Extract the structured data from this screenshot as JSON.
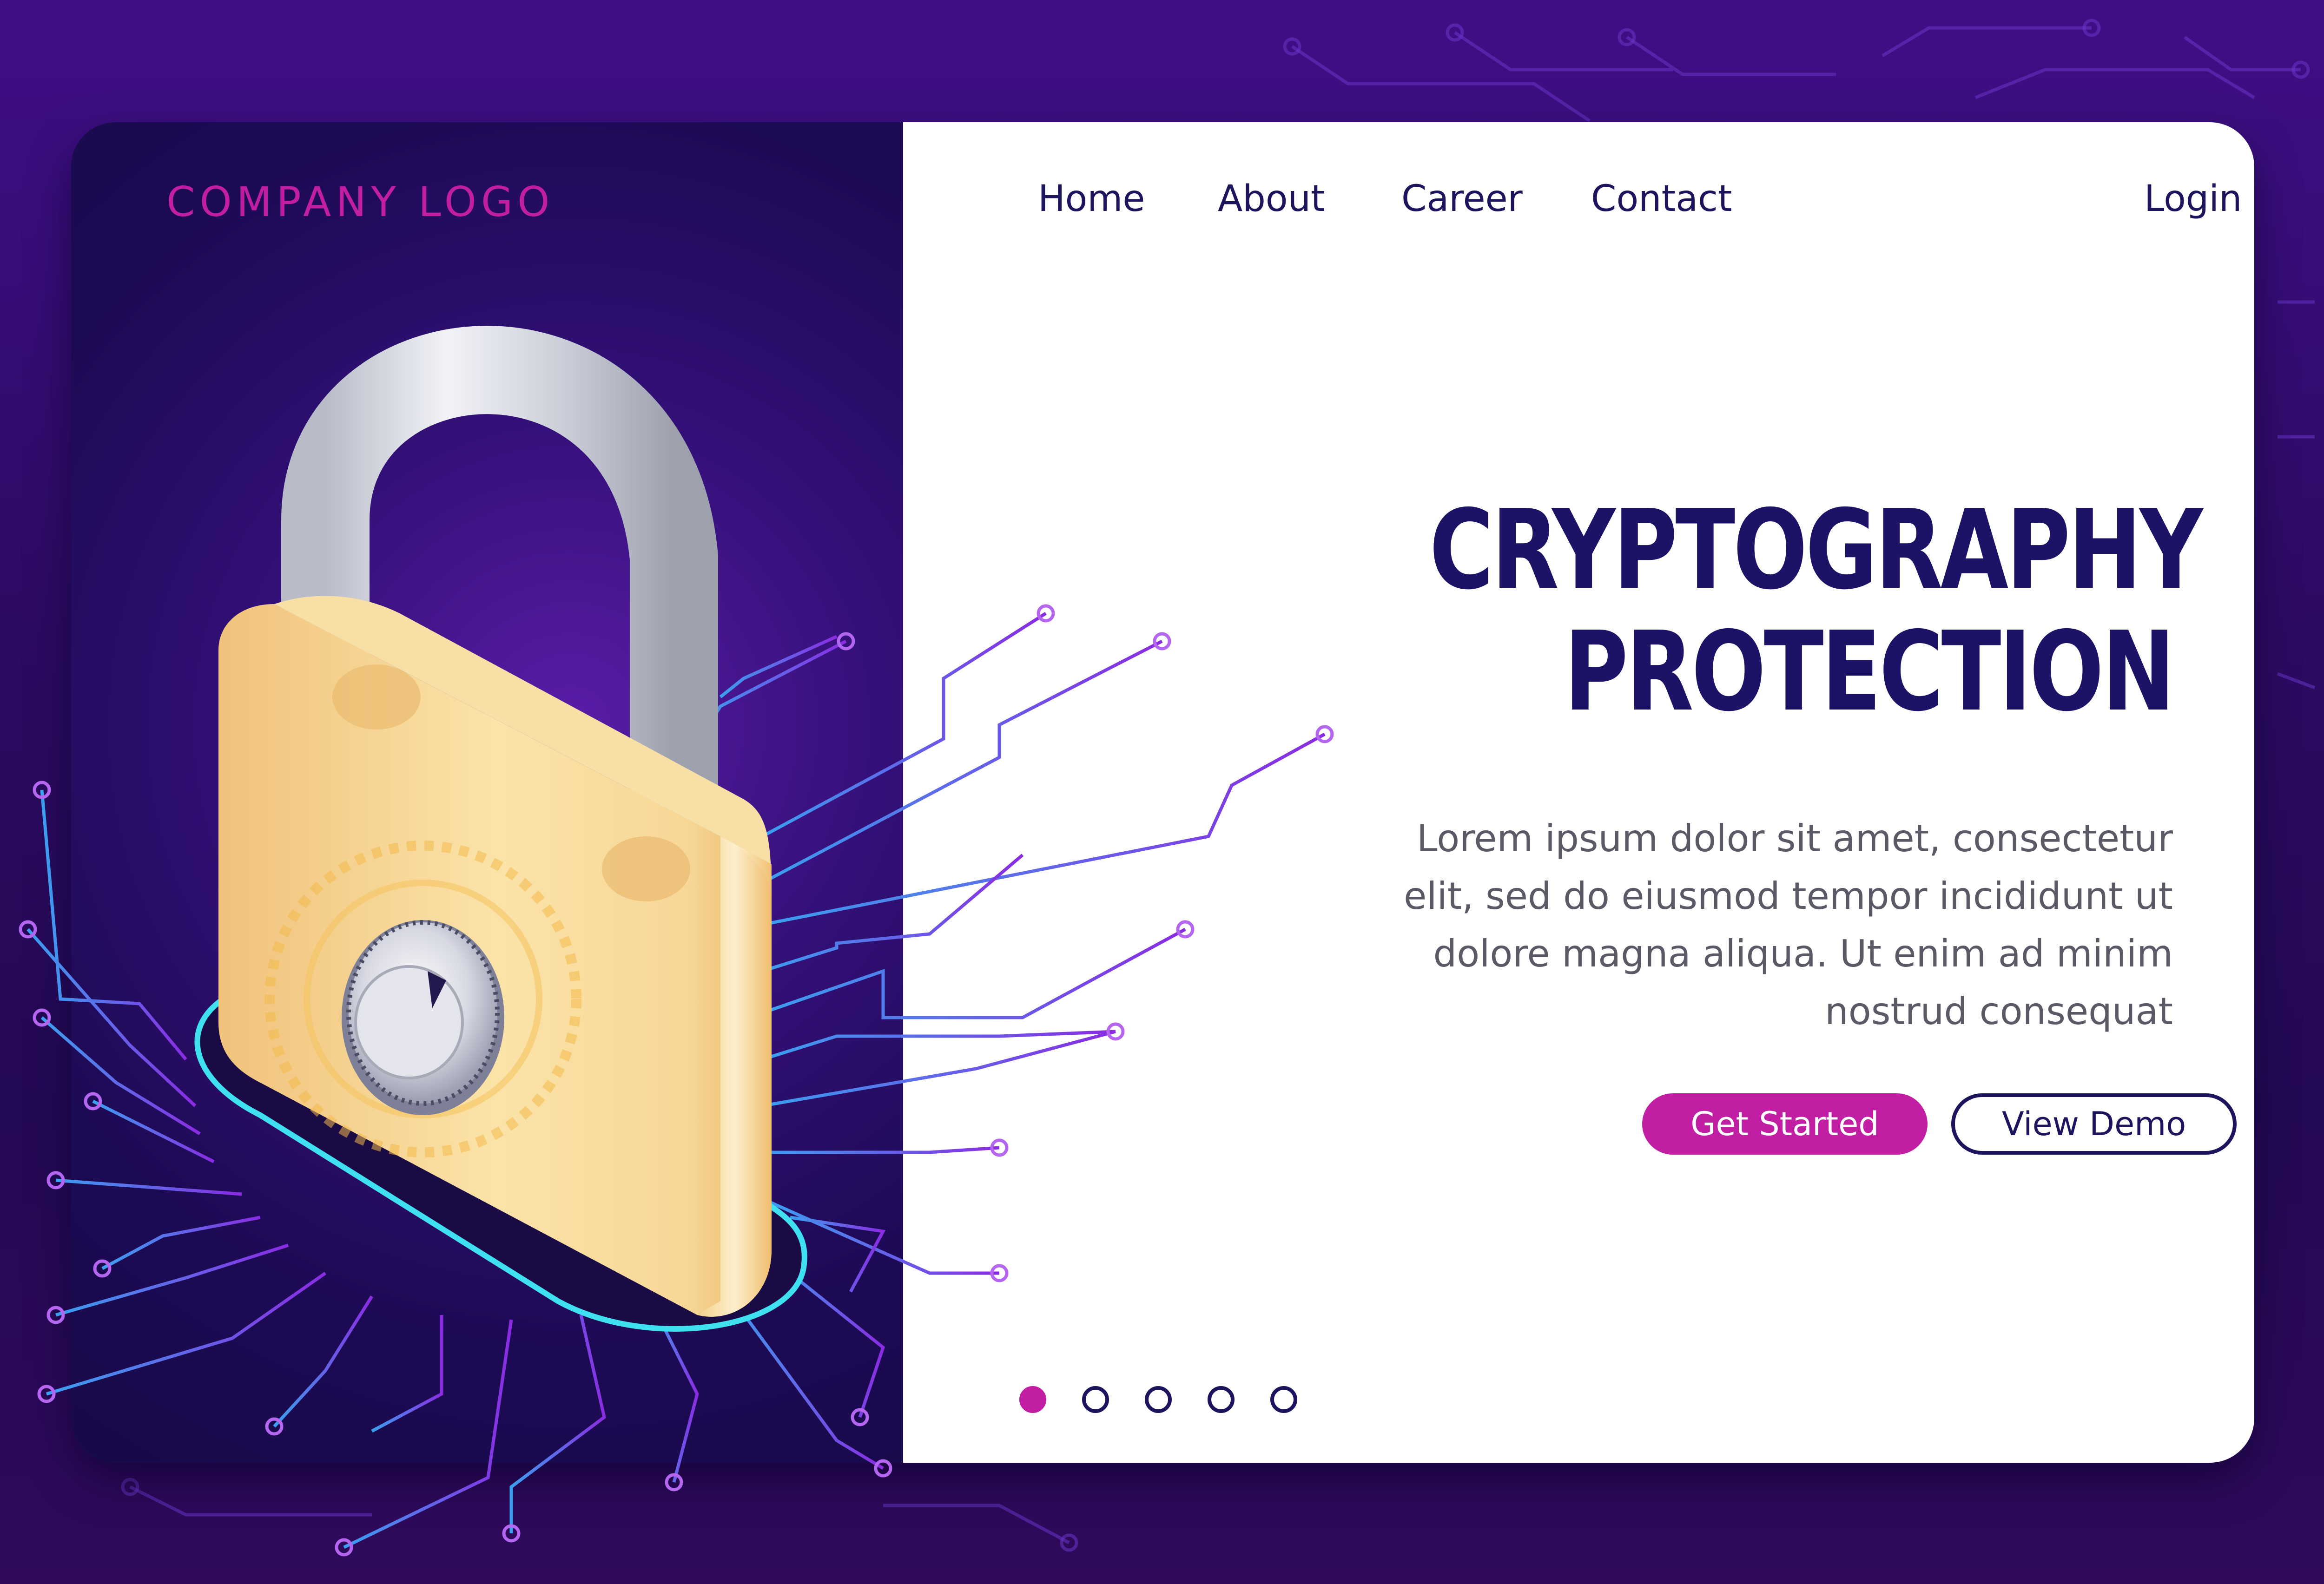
{
  "brand": {
    "logo_text": "COMPANY LOGO"
  },
  "nav": {
    "items": [
      "Home",
      "About",
      "Career",
      "Contact"
    ],
    "login": "Login"
  },
  "hero": {
    "title_line1": "CRYPTOGRAPHY",
    "title_line2": "PROTECTION",
    "description_lines": [
      "Lorem ipsum dolor sit amet, consectetur",
      "elit, sed do eiusmod tempor incididunt ut",
      "dolore magna aliqua. Ut enim ad minim",
      "nostrud consequat"
    ],
    "primary_button": "Get Started",
    "secondary_button": "View Demo"
  },
  "carousel": {
    "count": 5,
    "active_index": 0
  },
  "icons": [
    "padlock-icon",
    "combination-dial-icon",
    "circuit-lines-decoration"
  ],
  "colors": {
    "accent": "#c21ea4",
    "navy": "#1c1367",
    "background": "#2c0b63",
    "circuit": "#7a3bd9",
    "glow": "#3fe0f0",
    "lock_body": "#f5c87a"
  }
}
